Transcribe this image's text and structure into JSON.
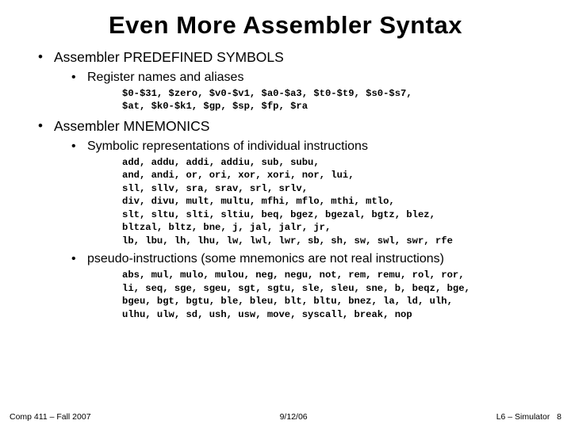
{
  "title": "Even More Assembler Syntax",
  "bullets": {
    "b1": "Assembler PREDEFINED SYMBOLS",
    "b1_1": "Register names and aliases",
    "code1": "$0-$31, $zero, $v0-$v1, $a0-$a3, $t0-$t9, $s0-$s7,\n$at, $k0-$k1, $gp, $sp, $fp, $ra",
    "b2": "Assembler MNEMONICS",
    "b2_1": "Symbolic representations of individual instructions",
    "code2": "add, addu, addi, addiu, sub, subu,\nand, andi, or, ori, xor, xori, nor, lui,\nsll, sllv, sra, srav, srl, srlv,\ndiv, divu, mult, multu, mfhi, mflo, mthi, mtlo,\nslt, sltu, slti, sltiu, beq, bgez, bgezal, bgtz, blez,\nbltzal, bltz, bne, j, jal, jalr, jr,\nlb, lbu, lh, lhu, lw, lwl, lwr, sb, sh, sw, swl, swr, rfe",
    "b2_2": "pseudo-instructions (some mnemonics are not real instructions)",
    "code3": "abs, mul, mulo, mulou, neg, negu, not, rem, remu, rol, ror,\nli, seq, sge, sgeu, sgt, sgtu, sle, sleu, sne, b, beqz, bge,\nbgeu, bgt, bgtu, ble, bleu, blt, bltu, bnez, la, ld, ulh,\nulhu, ulw, sd, ush, usw, move, syscall, break, nop"
  },
  "footer": {
    "left": "Comp 411 – Fall 2007",
    "center": "9/12/06",
    "right_label": "L6 – Simulator",
    "right_page": "8"
  }
}
